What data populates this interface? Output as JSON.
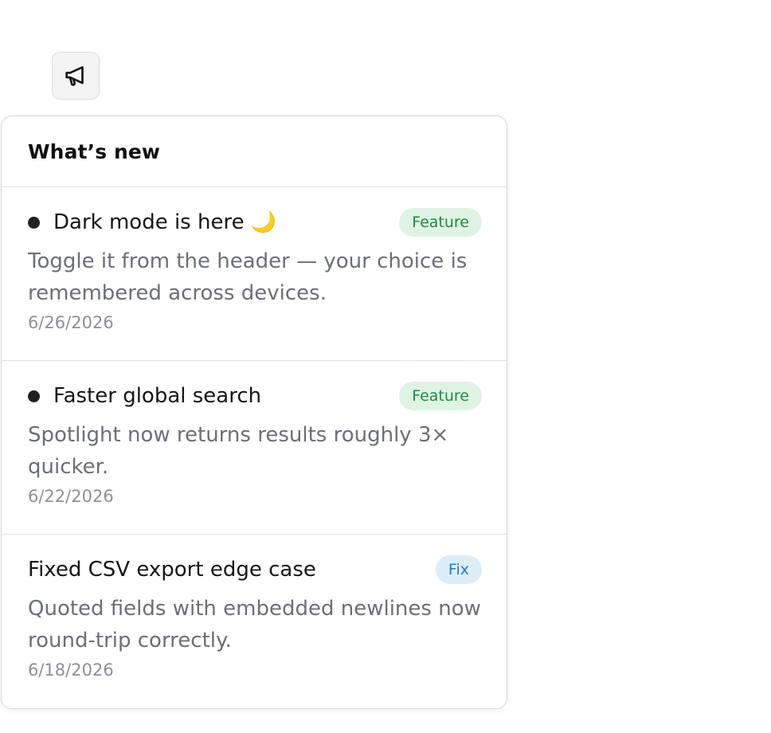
{
  "announcements_button": {
    "icon": "megaphone-icon"
  },
  "panel": {
    "title": "What’s new",
    "items": [
      {
        "title": "Dark mode is here 🌙",
        "badge": "Feature",
        "badge_type": "feature",
        "description": "Toggle it from the header — your choice is remembered across devices.",
        "date": "6/26/2026",
        "unread": true
      },
      {
        "title": "Faster global search",
        "badge": "Feature",
        "badge_type": "feature",
        "description": "Spotlight now returns results roughly 3× quicker.",
        "date": "6/22/2026",
        "unread": true
      },
      {
        "title": "Fixed CSV export edge case",
        "badge": "Fix",
        "badge_type": "fix",
        "description": "Quoted fields with embedded newlines now round-trip correctly.",
        "date": "6/18/2026",
        "unread": false
      }
    ]
  },
  "colors": {
    "feature_badge_bg": "#dff3e4",
    "feature_badge_text": "#1f8a3f",
    "fix_badge_bg": "#dcedf7",
    "fix_badge_text": "#1d7fb3",
    "unread_dot": "#222222"
  }
}
